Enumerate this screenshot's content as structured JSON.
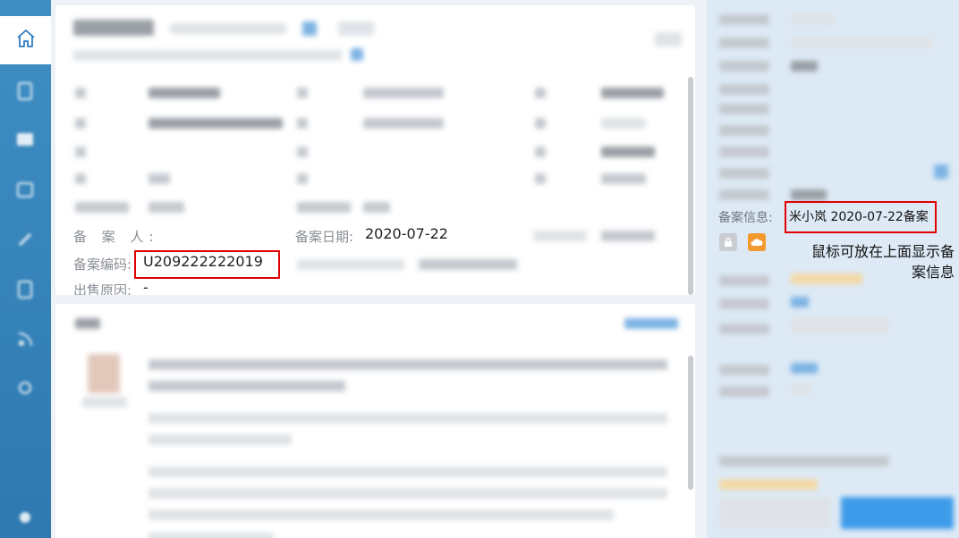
{
  "nav": {
    "items": [
      "home-icon",
      "document-icon",
      "image-icon",
      "calendar-icon",
      "rocket-icon",
      "list-icon",
      "rss-icon",
      "location-icon",
      "settings-icon"
    ]
  },
  "record": {
    "filer_label": "备 案 人:",
    "date_label": "备案日期:",
    "date_value": "2020-07-22",
    "code_label": "备案编码:",
    "code_value": "U209222222019",
    "reason_label": "出售原因:",
    "reason_value": "-"
  },
  "right_panel": {
    "info_label": "备案信息:",
    "info_value": "米小岚 2020-07-22备案",
    "annotation": "鼠标可放在上面显示备案信息"
  },
  "colors": {
    "highlight": "#e00000",
    "nav": "#3a87be",
    "orange": "#f39a2e"
  }
}
